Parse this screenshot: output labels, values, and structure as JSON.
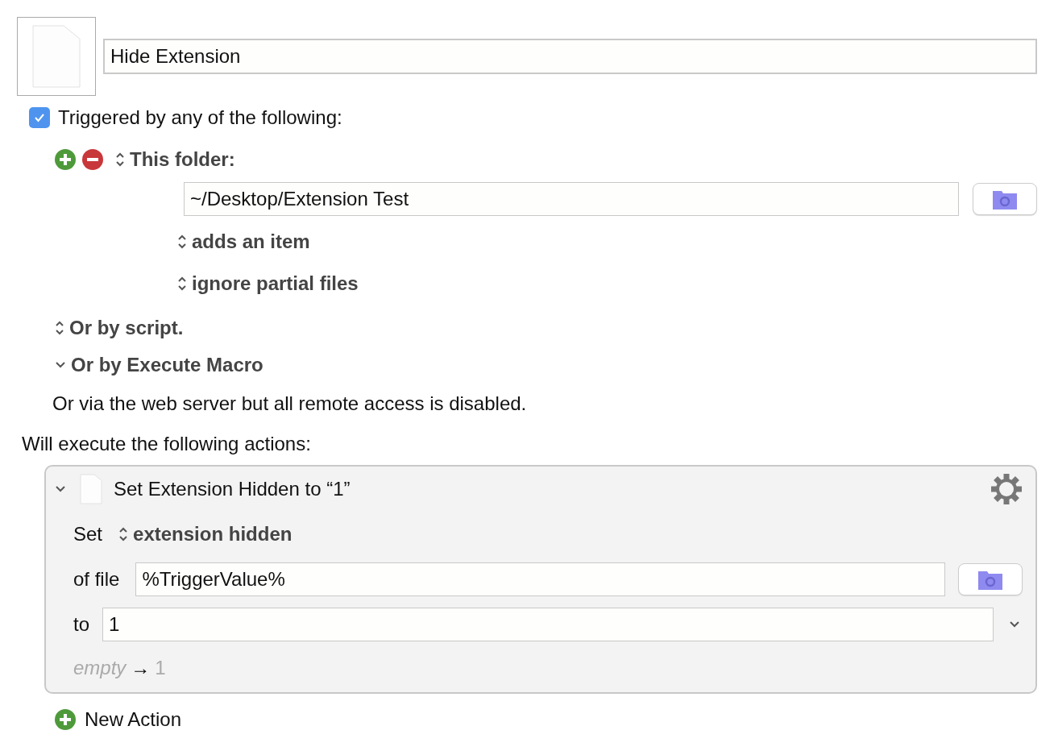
{
  "macro": {
    "name": "Hide Extension"
  },
  "trigger": {
    "label": "Triggered by any of the following:",
    "checked": true,
    "triggers": [
      {
        "kind": "folder",
        "label": "This folder:",
        "path": "~/Desktop/Extension Test",
        "options": [
          "adds an item",
          "ignore partial files"
        ]
      }
    ],
    "alternates": [
      {
        "kind": "popup",
        "label": "Or by script."
      },
      {
        "kind": "disclosure",
        "label": "Or by Execute Macro"
      }
    ],
    "note": "Or via the web server but all remote access is disabled."
  },
  "actions_heading": "Will execute the following actions:",
  "actions": [
    {
      "title": "Set Extension Hidden to “1”",
      "expanded": true,
      "set_label": "Set",
      "attribute": "extension hidden",
      "file_label": "of file",
      "file_value": "%TriggerValue%",
      "to_label": "to",
      "to_value": "1",
      "preview": {
        "from": "empty",
        "arrow": "→",
        "to": "1"
      }
    }
  ],
  "new_action": "New Action"
}
